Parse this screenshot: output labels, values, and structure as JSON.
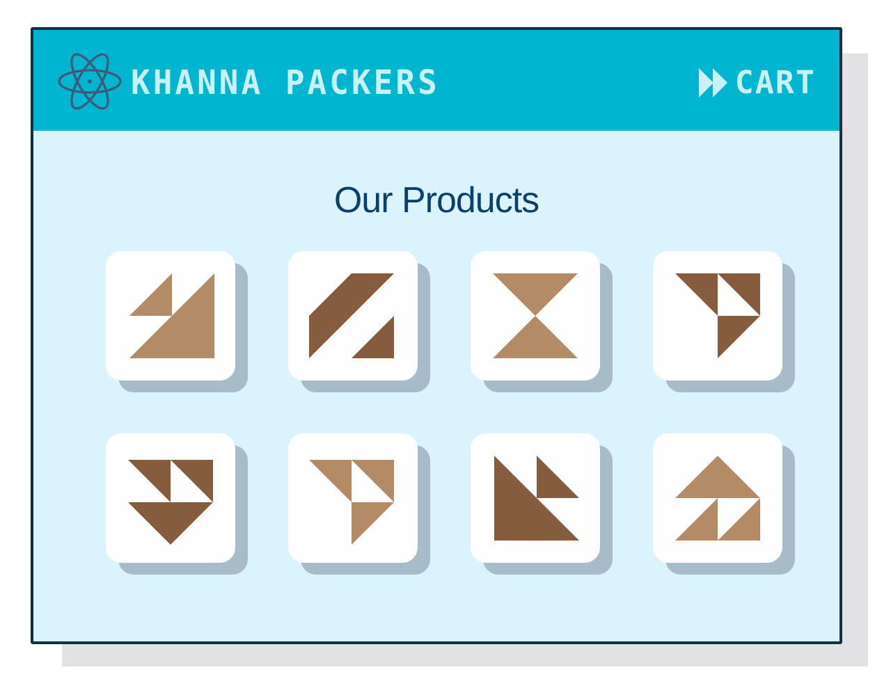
{
  "header": {
    "brand_name": "KHANNA PACKERS",
    "logo_icon": "atom-icon",
    "cart_label": "CART",
    "cart_icon": "fast-forward-icon"
  },
  "main": {
    "title": "Our Products"
  },
  "products": [
    {
      "icon": "triangles-pattern-1-icon",
      "colors": [
        "#b38b67"
      ]
    },
    {
      "icon": "triangles-pattern-2-icon",
      "colors": [
        "#855d3e"
      ]
    },
    {
      "icon": "hourglass-icon",
      "colors": [
        "#b38b67"
      ]
    },
    {
      "icon": "triangles-pattern-4-icon",
      "colors": [
        "#855d3e"
      ]
    },
    {
      "icon": "triangles-pattern-5-icon",
      "colors": [
        "#855d3e"
      ]
    },
    {
      "icon": "triangles-pattern-6-icon",
      "colors": [
        "#b38b67"
      ]
    },
    {
      "icon": "triangles-pattern-7-icon",
      "colors": [
        "#855d3e"
      ]
    },
    {
      "icon": "triangles-pattern-8-icon",
      "colors": [
        "#b38b67"
      ]
    }
  ],
  "colors": {
    "header_bg": "#00b5d0",
    "page_bg": "#daf3fd",
    "window_border": "#0f2f45",
    "header_text": "#c9f2f7",
    "title_text": "#0b3f6c",
    "tan": "#b38b67",
    "brown": "#855d3e"
  }
}
